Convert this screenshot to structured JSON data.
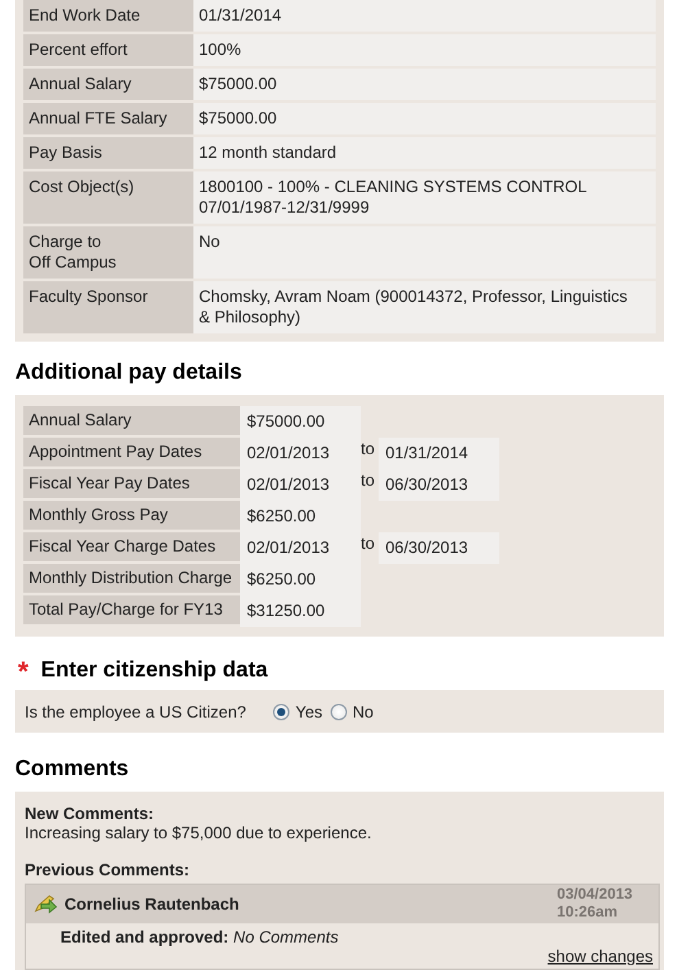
{
  "assignment_details": {
    "rows": [
      {
        "label": "End Work Date",
        "value": "01/31/2014"
      },
      {
        "label": "Percent effort",
        "value": "100%"
      },
      {
        "label": "Annual Salary",
        "value": "$75000.00"
      },
      {
        "label": "Annual FTE Salary",
        "value": "$75000.00"
      },
      {
        "label": "Pay Basis",
        "value": "12 month standard"
      },
      {
        "label": "Cost Object(s)",
        "value": "1800100 - 100% - CLEANING SYSTEMS CONTROL\n07/01/1987-12/31/9999"
      },
      {
        "label": "Charge to\nOff Campus",
        "value": "No"
      },
      {
        "label": "Faculty Sponsor",
        "value": "Chomsky, Avram Noam (900014372, Professor, Linguistics\n& Philosophy)"
      }
    ]
  },
  "additional_pay": {
    "title": "Additional pay details",
    "rows": [
      {
        "label": "Annual Salary",
        "value": "$75000.00"
      },
      {
        "label": "Appointment Pay Dates",
        "value": "02/01/2013",
        "to": "to",
        "end": "01/31/2014"
      },
      {
        "label": "Fiscal Year Pay Dates",
        "value": "02/01/2013",
        "to": "to",
        "end": "06/30/2013"
      },
      {
        "label": "Monthly Gross Pay",
        "value": "$6250.00"
      },
      {
        "label": "Fiscal Year Charge Dates",
        "value": "02/01/2013",
        "to": "to",
        "end": "06/30/2013"
      },
      {
        "label": "Monthly Distribution Charge",
        "value": "$6250.00"
      },
      {
        "label": "Total Pay/Charge for FY13",
        "value": "$31250.00"
      }
    ]
  },
  "citizenship": {
    "required_mark": "*",
    "title": "Enter citizenship data",
    "question": "Is the employee a US Citizen?",
    "options": [
      {
        "label": "Yes",
        "selected": true
      },
      {
        "label": "No",
        "selected": false
      }
    ]
  },
  "comments": {
    "title": "Comments",
    "new_label": "New Comments:",
    "new_text": "Increasing salary to $75,000 due to experience.",
    "previous_label": "Previous Comments:",
    "entries": [
      {
        "author": "Cornelius Rautenbach",
        "date": "03/04/2013",
        "time": "10:26am",
        "text": "**Edited and approved:** *No Comments*",
        "link": "show changes"
      }
    ]
  }
}
